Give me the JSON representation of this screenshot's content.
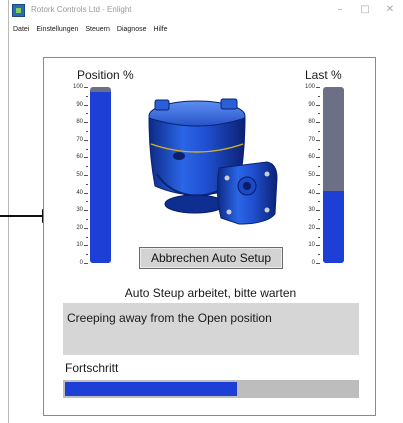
{
  "window": {
    "title": "Rotork Controls Ltd - Enlight",
    "controls": [
      "–",
      "□",
      "✕"
    ]
  },
  "menu": [
    "Datei",
    "Einstellungen",
    "Steuern",
    "Diagnose",
    "Hilfe"
  ],
  "position_gauge": {
    "title": "Position %",
    "ticks": [
      "100",
      "90",
      "80",
      "70",
      "60",
      "50",
      "40",
      "30",
      "20",
      "10",
      "0"
    ],
    "value_percent": 97
  },
  "load_gauge": {
    "title": "Last %",
    "ticks": [
      "100",
      "90",
      "80",
      "70",
      "60",
      "50",
      "40",
      "30",
      "20",
      "10",
      "0"
    ],
    "value_percent": 41
  },
  "actuator_image": {
    "description_icon": "rotork-actuator-image"
  },
  "setup_button": {
    "label": "Abbrechen Auto Setup"
  },
  "status": {
    "text": "Auto Steup arbeitet, bitte warten",
    "message": "Creeping away from the Open position"
  },
  "progress": {
    "label": "Fortschritt",
    "value_percent": 59
  },
  "colors": {
    "bar_fill": "#1e3fd6",
    "bar_track": "#6d6f86",
    "actuator_blue": "#1f55d6"
  }
}
